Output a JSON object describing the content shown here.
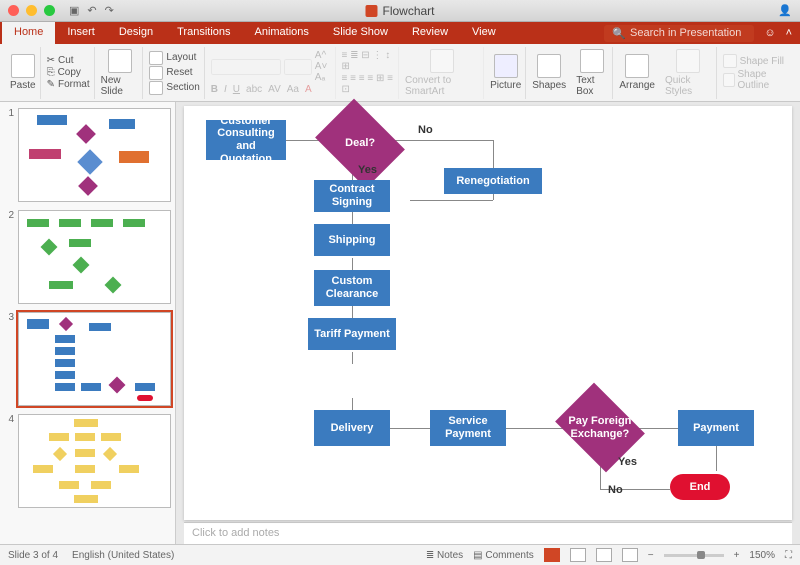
{
  "title": "Flowchart",
  "search_placeholder": "Search in Presentation",
  "tabs": [
    "Home",
    "Insert",
    "Design",
    "Transitions",
    "Animations",
    "Slide Show",
    "Review",
    "View"
  ],
  "ribbon": {
    "paste": "Paste",
    "cut": "Cut",
    "copy": "Copy",
    "format": "Format",
    "newslide": "New Slide",
    "layout": "Layout",
    "reset": "Reset",
    "section": "Section",
    "convert": "Convert to SmartArt",
    "picture": "Picture",
    "shapes": "Shapes",
    "textbox": "Text Box",
    "arrange": "Arrange",
    "quickstyles": "Quick Styles",
    "shapefill": "Shape Fill",
    "shapeoutline": "Shape Outline"
  },
  "slides": {
    "count": 4,
    "active": 3
  },
  "flowchart": {
    "customer": "Customer Consulting and Quotation",
    "deal": "Deal?",
    "no": "No",
    "yes": "Yes",
    "renegotiation": "Renegotiation",
    "contract": "Contract Signing",
    "shipping": "Shipping",
    "custom": "Custom Clearance",
    "tariff": "Tariff Payment",
    "delivery": "Delivery",
    "service": "Service Payment",
    "payforeign": "Pay Foreign Exchange?",
    "payment": "Payment",
    "end": "End"
  },
  "notes_placeholder": "Click to add notes",
  "status": {
    "slide": "Slide 3 of 4",
    "lang": "English (United States)",
    "notes": "Notes",
    "comments": "Comments",
    "zoom": "150%"
  }
}
